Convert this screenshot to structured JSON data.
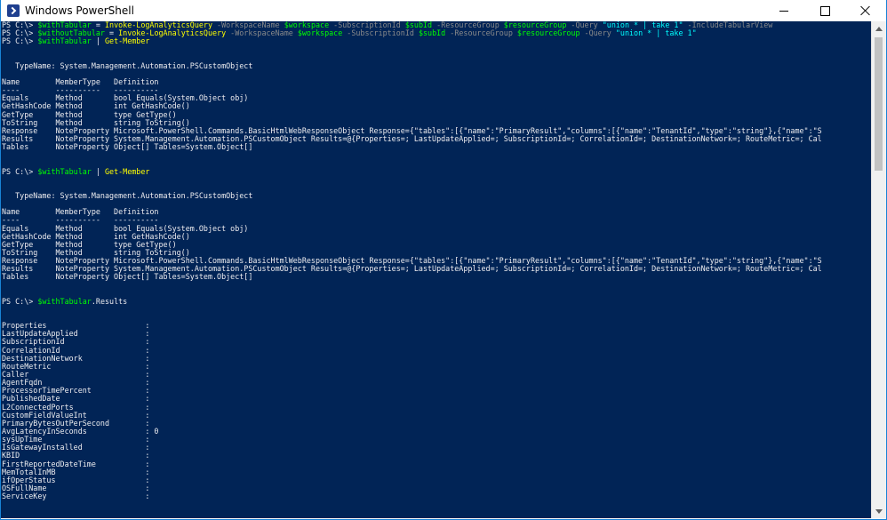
{
  "window": {
    "title": "Windows PowerShell",
    "icon": "powershell-icon",
    "controls": [
      "minimize-icon",
      "maximize-icon",
      "close-icon"
    ]
  },
  "colors": {
    "console_bg": "#012456",
    "text": "#eeedf0",
    "command": "#ffff00",
    "variable": "#00ff00",
    "parameter": "#8a8a8a",
    "string": "#00ffff"
  },
  "console": {
    "lines": [
      [
        [
          "p",
          "PS C:\\> "
        ],
        [
          "v",
          "$withTabular"
        ],
        [
          "p",
          " = "
        ],
        [
          "c",
          "Invoke-LogAnalyticsQuery"
        ],
        [
          "a",
          " -WorkspaceName "
        ],
        [
          "v",
          "$workspace"
        ],
        [
          "a",
          " -SubscriptionId "
        ],
        [
          "v",
          "$subId"
        ],
        [
          "a",
          " -ResourceGroup "
        ],
        [
          "v",
          "$resourceGroup"
        ],
        [
          "a",
          " -Query "
        ],
        [
          "s",
          "\"union * | take 1\""
        ],
        [
          "a",
          " -IncludeTabularView"
        ]
      ],
      [
        [
          "p",
          "PS C:\\> "
        ],
        [
          "v",
          "$withoutTabular"
        ],
        [
          "p",
          " = "
        ],
        [
          "c",
          "Invoke-LogAnalyticsQuery"
        ],
        [
          "a",
          " -WorkspaceName "
        ],
        [
          "v",
          "$workspace"
        ],
        [
          "a",
          " -SubscriptionId "
        ],
        [
          "v",
          "$subId"
        ],
        [
          "a",
          " -ResourceGroup "
        ],
        [
          "v",
          "$resourceGroup"
        ],
        [
          "a",
          " -Query "
        ],
        [
          "s",
          "\"union * | take 1\""
        ]
      ],
      [
        [
          "p",
          "PS C:\\> "
        ],
        [
          "v",
          "$withTabular"
        ],
        [
          "p",
          " | "
        ],
        [
          "c",
          "Get-Member"
        ]
      ],
      [],
      [],
      [
        [
          "p",
          "   TypeName: System.Management.Automation.PSCustomObject"
        ]
      ],
      [],
      [
        [
          "p",
          "Name        MemberType   Definition"
        ]
      ],
      [
        [
          "p",
          "----        ----------   ----------"
        ]
      ],
      [
        [
          "p",
          "Equals      Method       bool Equals(System.Object obj)"
        ]
      ],
      [
        [
          "p",
          "GetHashCode Method       int GetHashCode()"
        ]
      ],
      [
        [
          "p",
          "GetType     Method       type GetType()"
        ]
      ],
      [
        [
          "p",
          "ToString    Method       string ToString()"
        ]
      ],
      [
        [
          "p",
          "Response    NoteProperty Microsoft.PowerShell.Commands.BasicHtmlWebResponseObject Response={\"tables\":[{\"name\":\"PrimaryResult\",\"columns\":[{\"name\":\"TenantId\",\"type\":\"string\"},{\"name\":\"S"
        ]
      ],
      [
        [
          "p",
          "Results     NoteProperty System.Management.Automation.PSCustomObject Results=@{Properties=; LastUpdateApplied=; SubscriptionId=; CorrelationId=; DestinationNetwork=; RouteMetric=; Cal"
        ]
      ],
      [
        [
          "p",
          "Tables      NoteProperty Object[] Tables=System.Object[]"
        ]
      ],
      [],
      [],
      [
        [
          "p",
          "PS C:\\> "
        ],
        [
          "v",
          "$withTabular"
        ],
        [
          "p",
          " | "
        ],
        [
          "c",
          "Get-Member"
        ]
      ],
      [],
      [],
      [
        [
          "p",
          "   TypeName: System.Management.Automation.PSCustomObject"
        ]
      ],
      [],
      [
        [
          "p",
          "Name        MemberType   Definition"
        ]
      ],
      [
        [
          "p",
          "----        ----------   ----------"
        ]
      ],
      [
        [
          "p",
          "Equals      Method       bool Equals(System.Object obj)"
        ]
      ],
      [
        [
          "p",
          "GetHashCode Method       int GetHashCode()"
        ]
      ],
      [
        [
          "p",
          "GetType     Method       type GetType()"
        ]
      ],
      [
        [
          "p",
          "ToString    Method       string ToString()"
        ]
      ],
      [
        [
          "p",
          "Response    NoteProperty Microsoft.PowerShell.Commands.BasicHtmlWebResponseObject Response={\"tables\":[{\"name\":\"PrimaryResult\",\"columns\":[{\"name\":\"TenantId\",\"type\":\"string\"},{\"name\":\"S"
        ]
      ],
      [
        [
          "p",
          "Results     NoteProperty System.Management.Automation.PSCustomObject Results=@{Properties=; LastUpdateApplied=; SubscriptionId=; CorrelationId=; DestinationNetwork=; RouteMetric=; Cal"
        ]
      ],
      [
        [
          "p",
          "Tables      NoteProperty Object[] Tables=System.Object[]"
        ]
      ],
      [],
      [],
      [
        [
          "p",
          "PS C:\\> "
        ],
        [
          "v",
          "$withTabular"
        ],
        [
          "p",
          ".Results"
        ]
      ],
      [],
      [],
      [
        [
          "p",
          "Properties                      :"
        ]
      ],
      [
        [
          "p",
          "LastUpdateApplied               :"
        ]
      ],
      [
        [
          "p",
          "SubscriptionId                  :"
        ]
      ],
      [
        [
          "p",
          "CorrelationId                   :"
        ]
      ],
      [
        [
          "p",
          "DestinationNetwork              :"
        ]
      ],
      [
        [
          "p",
          "RouteMetric                     :"
        ]
      ],
      [
        [
          "p",
          "Caller                          :"
        ]
      ],
      [
        [
          "p",
          "AgentFqdn                       :"
        ]
      ],
      [
        [
          "p",
          "ProcessorTimePercent            :"
        ]
      ],
      [
        [
          "p",
          "PublishedDate                   :"
        ]
      ],
      [
        [
          "p",
          "L2ConnectedPorts                :"
        ]
      ],
      [
        [
          "p",
          "CustomFieldValueInt             :"
        ]
      ],
      [
        [
          "p",
          "PrimaryBytesOutPerSecond        :"
        ]
      ],
      [
        [
          "p",
          "AvgLatencyInSeconds             : 0"
        ]
      ],
      [
        [
          "p",
          "sysUpTime                       :"
        ]
      ],
      [
        [
          "p",
          "IsGatewayInstalled              :"
        ]
      ],
      [
        [
          "p",
          "KBID                            :"
        ]
      ],
      [
        [
          "p",
          "FirstReportedDateTime           :"
        ]
      ],
      [
        [
          "p",
          "MemTotalInMB                    :"
        ]
      ],
      [
        [
          "p",
          "ifOperStatus                    :"
        ]
      ],
      [
        [
          "p",
          "OSFullName                      :"
        ]
      ],
      [
        [
          "p",
          "ServiceKey                      :"
        ]
      ]
    ]
  }
}
